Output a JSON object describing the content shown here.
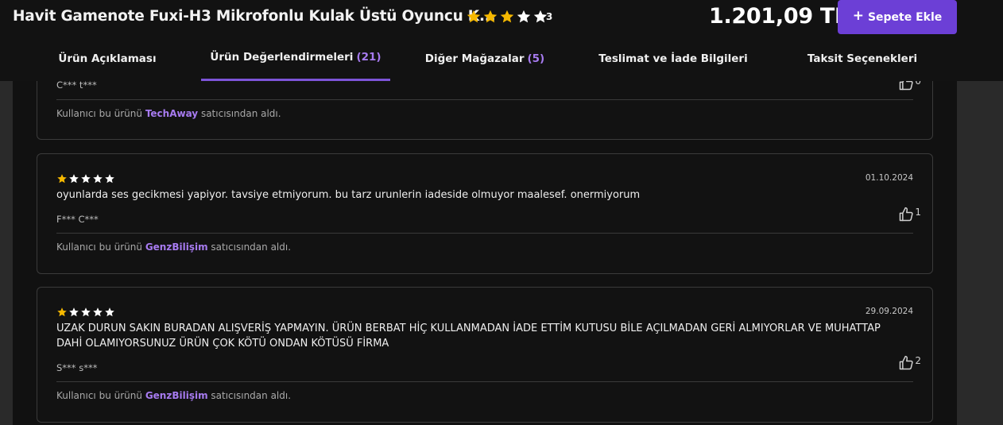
{
  "header": {
    "product_title": "Havit Gamenote Fuxi-H3 Mikrofonlu Kulak Üstü Oyuncu K...",
    "rating_filled": 3,
    "rating_max": 5,
    "rating_count": "3",
    "price": "1.201,09 TL",
    "cart_plus": "+",
    "cart_label": "Sepete Ekle"
  },
  "tabs": [
    {
      "label": "Ürün Açıklaması",
      "count": ""
    },
    {
      "label": "Ürün Değerlendirmeleri",
      "count": "(21)"
    },
    {
      "label": "Diğer Mağazalar",
      "count": "(5)"
    },
    {
      "label": "Teslimat ve İade Bilgileri",
      "count": ""
    },
    {
      "label": "Taksit Seçenekleri",
      "count": ""
    }
  ],
  "active_tab_index": 1,
  "reviews": [
    {
      "rating": 0,
      "date": "",
      "text": "",
      "user": "C*** t***",
      "likes": "0",
      "seller_prefix": "Kullanıcı bu ürünü",
      "seller_name": "TechAway",
      "seller_suffix": "satıcısından aldı."
    },
    {
      "rating": 1,
      "date": "01.10.2024",
      "text": "oyunlarda ses gecikmesi yapiyor. tavsiye etmiyorum. bu tarz urunlerin iadeside olmuyor maalesef. onermiyorum",
      "user": "F*** C***",
      "likes": "1",
      "seller_prefix": "Kullanıcı bu ürünü",
      "seller_name": "GenzBilişim",
      "seller_suffix": "satıcısından aldı."
    },
    {
      "rating": 1,
      "date": "29.09.2024",
      "text": "UZAK DURUN SAKIN BURADAN ALIŞVERİŞ YAPMAYIN. ÜRÜN BERBAT HİÇ KULLANMADAN İADE ETTİM KUTUSU BİLE AÇILMADAN GERİ ALMIYORLAR VE MUHATTAP DAHİ OLAMIYORSUNUZ ÜRÜN ÇOK KÖTÜ ONDAN KÖTÜSÜ FİRMA",
      "user": "S*** s***",
      "likes": "2",
      "seller_prefix": "Kullanıcı bu ürünü",
      "seller_name": "GenzBilişim",
      "seller_suffix": "satıcısından aldı."
    }
  ],
  "icons": {
    "star": "star-icon",
    "thumbs_up": "thumbs-up-icon",
    "plus": "plus-icon"
  },
  "colors": {
    "accent": "#6c3fd6",
    "accent_text": "#a77bf0",
    "star_filled": "#f5b800",
    "star_empty": "#ffffff"
  }
}
